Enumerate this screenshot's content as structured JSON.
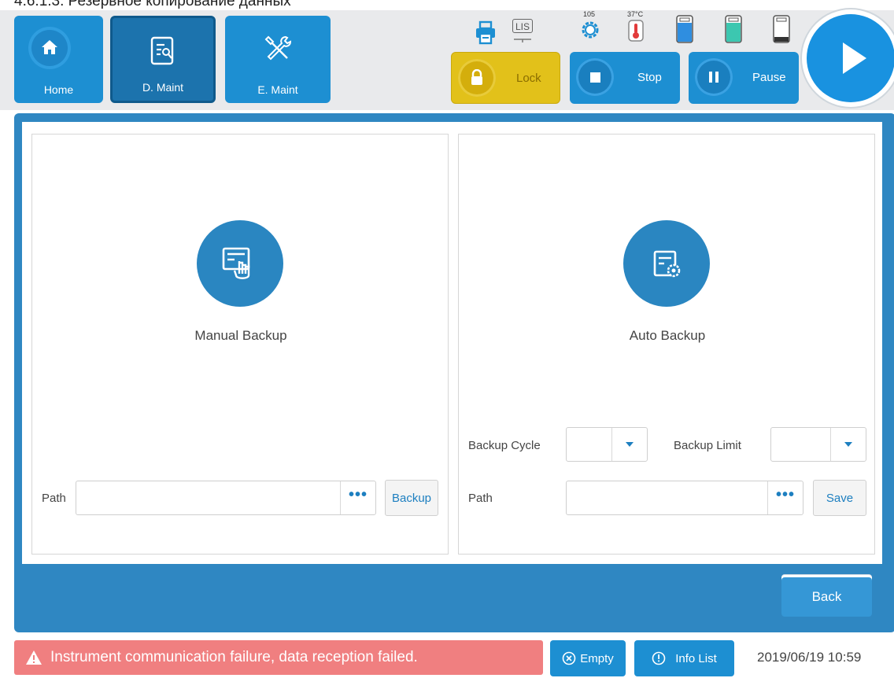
{
  "caption": "4.6.1.3. Резервное копирование данных",
  "nav": {
    "home_label": "Home",
    "dmaint_label": "D. Maint",
    "emaint_label": "E. Maint"
  },
  "status": {
    "printer_icon": "printer-icon",
    "lis_label": "LIS",
    "fan_value": "105",
    "temp_value": "37°C"
  },
  "controls": {
    "lock_label": "Lock",
    "stop_label": "Stop",
    "pause_label": "Pause"
  },
  "manual": {
    "title": "Manual Backup",
    "path_label": "Path",
    "path_value": "",
    "dots": "•••",
    "backup_label": "Backup"
  },
  "auto": {
    "title": "Auto Backup",
    "cycle_label": "Backup Cycle",
    "cycle_value": "",
    "limit_label": "Backup Limit",
    "limit_value": "",
    "path_label": "Path",
    "path_value": "",
    "dots": "•••",
    "save_label": "Save"
  },
  "back_label": "Back",
  "footer": {
    "alarm_text": "Instrument communication failure, data reception failed.",
    "empty_label": "Empty",
    "infolist_label": "Info List",
    "datetime": "2019/06/19 10:59"
  },
  "colors": {
    "accent": "#1d8fd2",
    "frame": "#2f87c2",
    "lock": "#e2c11a",
    "alarm": "#f07f80"
  }
}
